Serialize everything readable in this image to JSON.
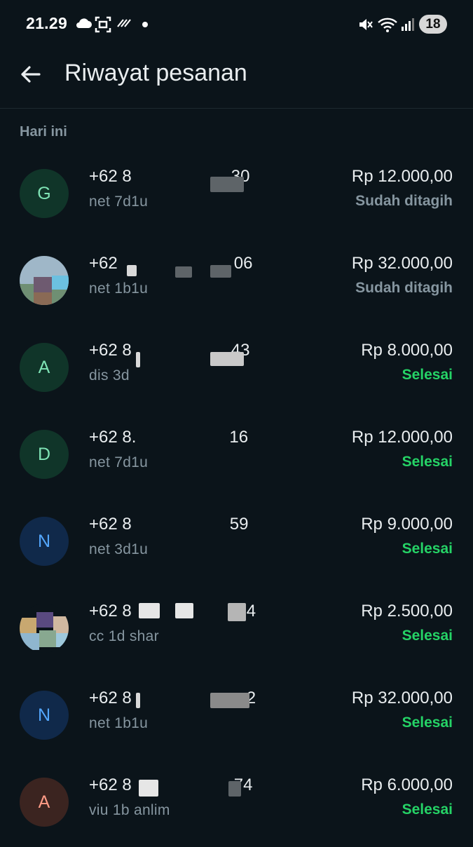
{
  "status_bar": {
    "time": "21.29",
    "battery": "18",
    "icons": [
      "cloud-icon",
      "screenshot-icon",
      "no-sync-icon",
      "notification-dot-icon",
      "mute-icon",
      "wifi-icon",
      "signal-icon",
      "battery-icon"
    ]
  },
  "header": {
    "title": "Riwayat pesanan",
    "back_icon": "arrow-left-icon"
  },
  "section_label": "Hari ini",
  "colors": {
    "background": "#0b141a",
    "billed": "#8696a0",
    "done": "#25d366",
    "avatar_green_bg": "#103529",
    "avatar_green_fg": "#7fe3b5",
    "avatar_blue_bg": "#10294a",
    "avatar_blue_fg": "#53a6fd",
    "avatar_orange_bg": "#3b2420",
    "avatar_orange_fg": "#ff9b86"
  },
  "orders": [
    {
      "initial": "G",
      "phone_start": "+62 8",
      "phone_end": "30",
      "note": "net 7d1u",
      "price": "Rp 12.000,00",
      "status": "Sudah ditagih"
    },
    {
      "initial": "",
      "phone_start": "+62",
      "phone_end": "06",
      "note": "net 1b1u",
      "price": "Rp 32.000,00",
      "status": "Sudah ditagih"
    },
    {
      "initial": "A",
      "phone_start": "+62 8",
      "phone_end": "43",
      "note": "dis 3d",
      "price": "Rp 8.000,00",
      "status": "Selesai"
    },
    {
      "initial": "D",
      "phone_start": "+62 8.",
      "phone_end": "16",
      "note": "net 7d1u",
      "price": "Rp 12.000,00",
      "status": "Selesai"
    },
    {
      "initial": "N",
      "phone_start": "+62 8",
      "phone_end": "59",
      "note": "net 3d1u",
      "price": "Rp 9.000,00",
      "status": "Selesai"
    },
    {
      "initial": "",
      "phone_start": "+62 8",
      "phone_end": "4",
      "note": "cc 1d shar",
      "price": "Rp 2.500,00",
      "status": "Selesai"
    },
    {
      "initial": "N",
      "phone_start": "+62 8",
      "phone_end": "2",
      "note": "net 1b1u",
      "price": "Rp 32.000,00",
      "status": "Selesai"
    },
    {
      "initial": "A",
      "phone_start": "+62 8",
      "phone_end": "74",
      "note": "viu 1b anlim",
      "price": "Rp 6.000,00",
      "status": "Selesai"
    }
  ]
}
